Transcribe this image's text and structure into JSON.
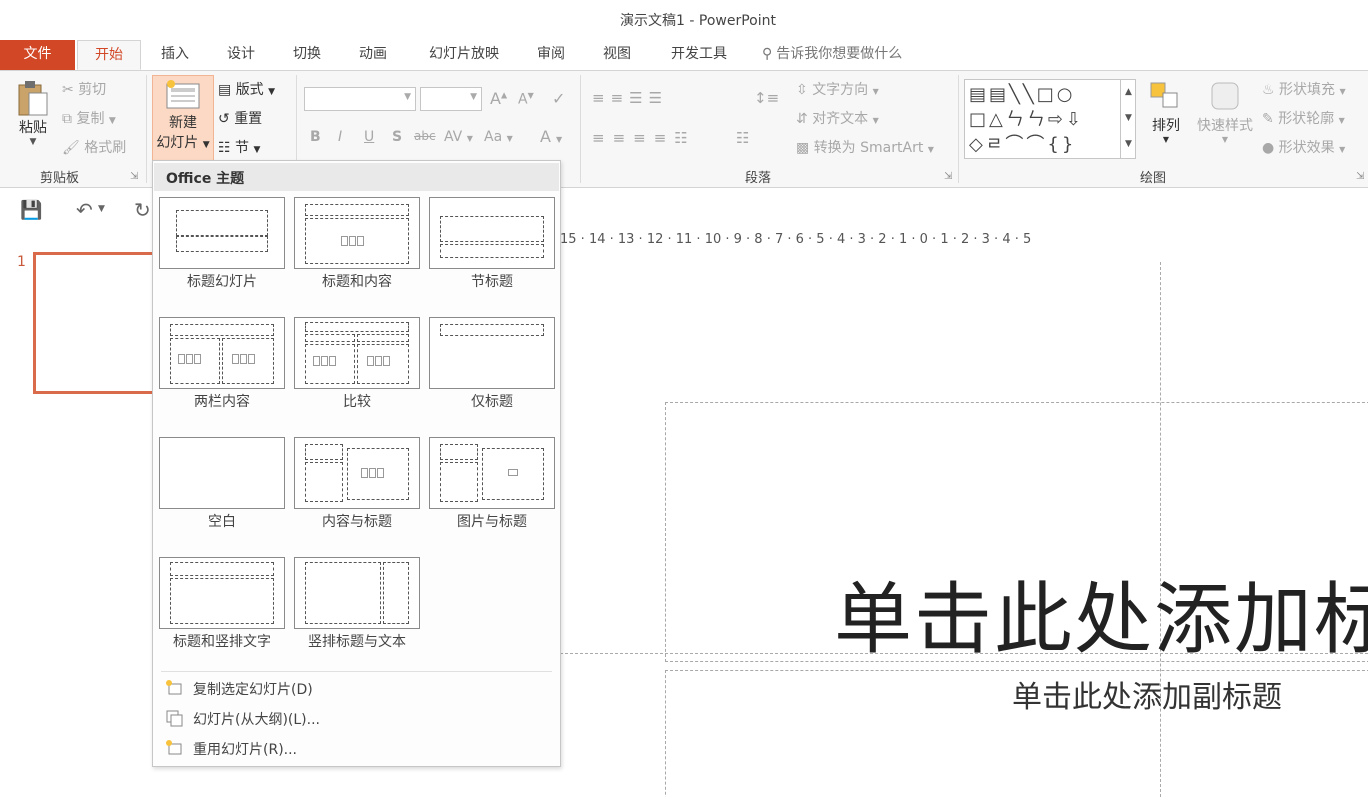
{
  "window": {
    "title": "演示文稿1 - PowerPoint"
  },
  "tabs": [
    {
      "label": "文件"
    },
    {
      "label": "开始"
    },
    {
      "label": "插入"
    },
    {
      "label": "设计"
    },
    {
      "label": "切换"
    },
    {
      "label": "动画"
    },
    {
      "label": "幻灯片放映"
    },
    {
      "label": "审阅"
    },
    {
      "label": "视图"
    },
    {
      "label": "开发工具"
    }
  ],
  "tell_me": "告诉我你想要做什么",
  "ribbon": {
    "clipboard": {
      "paste": "粘贴",
      "cut": "剪切",
      "copy": "复制",
      "format_painter": "格式刷",
      "group": "剪贴板"
    },
    "slides": {
      "new_slide_line1": "新建",
      "new_slide_line2": "幻灯片",
      "layout": "版式",
      "reset": "重置",
      "section": "节"
    },
    "font": {
      "bold": "B",
      "italic": "I",
      "underline": "U",
      "shadow": "S",
      "strike": "abc",
      "spacing": "AV",
      "case": "Aa",
      "color": "A"
    },
    "paragraph": {
      "text_direction": "文字方向",
      "align_text": "对齐文本",
      "smartart": "转换为 SmartArt",
      "group": "段落"
    },
    "drawing": {
      "arrange": "排列",
      "quick_styles": "快速样式",
      "shape_fill": "形状填充",
      "shape_outline": "形状轮廓",
      "shape_effects": "形状效果",
      "group": "绘图"
    }
  },
  "slide_panel": {
    "number": "1"
  },
  "ruler": {
    "text": "15 · 14 · 13 · 12 · 11 · 10 · 9 · 8 · 7 · 6 · 5 · 4 · 3 · 2 · 1 · 0 · 1 · 2 · 3 · 4 · 5"
  },
  "canvas": {
    "title_placeholder": "单击此处添加标",
    "subtitle_placeholder": "单击此处添加副标题"
  },
  "new_slide_menu": {
    "header": "Office 主题",
    "layouts": [
      {
        "name": "标题幻灯片"
      },
      {
        "name": "标题和内容"
      },
      {
        "name": "节标题"
      },
      {
        "name": "两栏内容"
      },
      {
        "name": "比较"
      },
      {
        "name": "仅标题"
      },
      {
        "name": "空白"
      },
      {
        "name": "内容与标题"
      },
      {
        "name": "图片与标题"
      },
      {
        "name": "标题和竖排文字"
      },
      {
        "name": "竖排标题与文本"
      }
    ],
    "actions": [
      {
        "label": "复制选定幻灯片(D)"
      },
      {
        "label": "幻灯片(从大纲)(L)..."
      },
      {
        "label": "重用幻灯片(R)..."
      }
    ]
  },
  "colors": {
    "accent": "#d24726",
    "selection": "#d96b4b"
  }
}
